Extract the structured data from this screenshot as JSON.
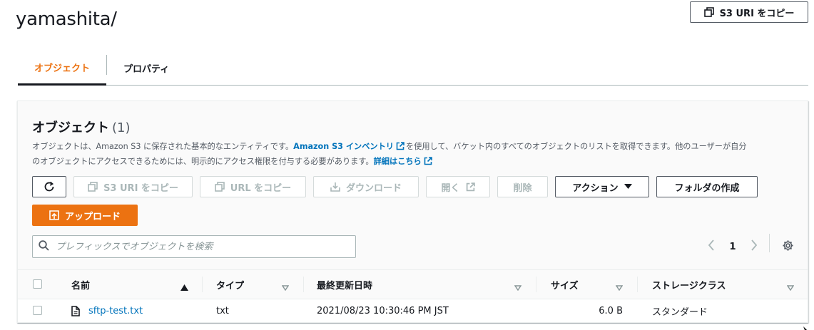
{
  "page": {
    "title": "yamashita/",
    "copy_uri_label": "S3 URI をコピー"
  },
  "tabs": [
    {
      "label": "オブジェクト",
      "active": true
    },
    {
      "label": "プロパティ",
      "active": false
    }
  ],
  "panel": {
    "title": "オブジェクト",
    "count": "(1)",
    "desc_1": "オブジェクトは、Amazon S3 に保存された基本的なエンティティです。",
    "desc_link_1": "Amazon S3 インベントリ",
    "desc_2": "を使用して、バケット内のすべてのオブジェクトのリストを取得できます。他のユーザーが自分",
    "desc_3": "のオブジェクトにアクセスできるためには、明示的にアクセス権限を付与する必要があります。",
    "desc_link_2": "詳細はこちら"
  },
  "toolbar": {
    "refresh_icon": "refresh-icon",
    "copy_s3_uri": "S3 URI をコピー",
    "copy_url": "URL をコピー",
    "download": "ダウンロード",
    "open": "開く",
    "delete": "削除",
    "actions": "アクション",
    "create_folder": "フォルダの作成",
    "upload": "アップロード"
  },
  "search": {
    "placeholder": "プレフィックスでオブジェクトを検索",
    "value": ""
  },
  "pagination": {
    "current_page": "1"
  },
  "table": {
    "columns": [
      "名前",
      "タイプ",
      "最終更新日時",
      "サイズ",
      "ストレージクラス"
    ],
    "rows": [
      {
        "name": "sftp-test.txt",
        "type": "txt",
        "modified": "2021/08/23 10:30:46 PM JST",
        "size": "6.0 B",
        "storage_class": "スタンダード"
      }
    ]
  },
  "colors": {
    "accent": "#ec7211",
    "link": "#0073bb",
    "text": "#16191f",
    "muted": "#545b64",
    "disabled": "#aab7b8"
  }
}
